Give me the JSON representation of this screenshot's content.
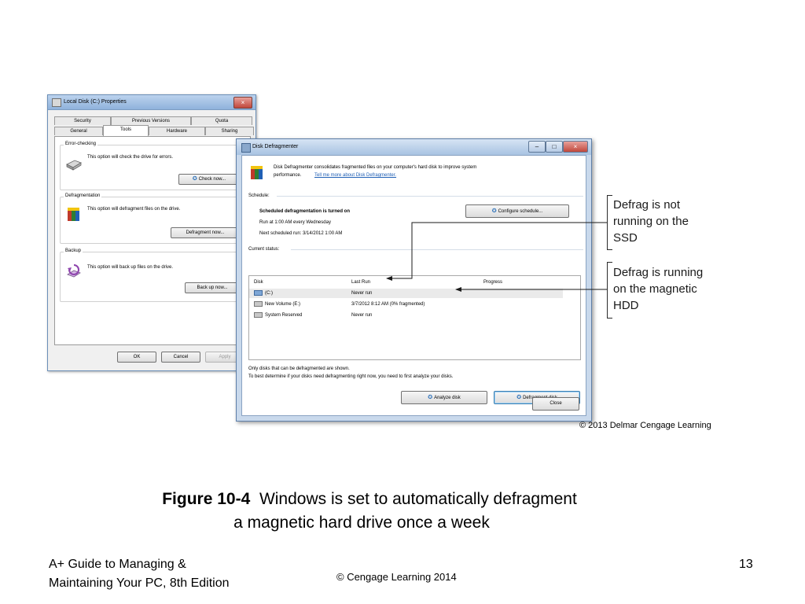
{
  "properties_window": {
    "title": "Local Disk (C:) Properties",
    "close_glyph": "×",
    "tabs_back": [
      "Security",
      "Previous Versions",
      "Quota"
    ],
    "tabs_front": [
      "General",
      "Tools",
      "Hardware",
      "Sharing"
    ],
    "active_tab": "Tools",
    "error_checking": {
      "title": "Error-checking",
      "text": "This option will check the drive for errors.",
      "button": "Check now..."
    },
    "defragmentation": {
      "title": "Defragmentation",
      "text": "This option will defragment files on the drive.",
      "button": "Defragment now..."
    },
    "backup": {
      "title": "Backup",
      "text": "This option will back up files on the drive.",
      "button": "Back up now..."
    },
    "buttons": {
      "ok": "OK",
      "cancel": "Cancel",
      "apply": "Apply"
    }
  },
  "defrag_window": {
    "title": "Disk Defragmenter",
    "window_buttons": {
      "minimize": "–",
      "maximize": "□",
      "close": "×"
    },
    "intro_text": "Disk Defragmenter consolidates fragmented files on your computer's hard disk to improve system",
    "intro_text2": "performance.",
    "intro_link": "Tell me more about Disk Defragmenter.",
    "schedule_label": "Schedule:",
    "schedule_status": "Scheduled defragmentation is turned on",
    "schedule_run": "Run at 1:00 AM every Wednesday",
    "schedule_next": "Next scheduled run: 3/14/2012 1:00 AM",
    "configure_button": "Configure schedule...",
    "current_status_label": "Current status:",
    "columns": [
      "Disk",
      "Last Run",
      "Progress"
    ],
    "disks": [
      {
        "disk": "(C:)",
        "last_run": "Never run",
        "progress": ""
      },
      {
        "disk": "New Volume (E:)",
        "last_run": "3/7/2012 8:12 AM (0% fragmented)",
        "progress": ""
      },
      {
        "disk": "System Reserved",
        "last_run": "Never run",
        "progress": ""
      }
    ],
    "note1": "Only disks that can be defragmented are shown.",
    "note2": "To best determine if your disks need defragmenting right now, you need to first analyze your disks.",
    "analyze_button": "Analyze disk",
    "defragment_button": "Defragment disk",
    "close_button": "Close"
  },
  "callouts": {
    "ssd": [
      "Defrag is not",
      "running on the",
      "SSD"
    ],
    "hdd": [
      "Defrag is running",
      "on the magnetic",
      "HDD"
    ]
  },
  "copyright_image": "© 2013 Delmar Cengage Learning",
  "caption": {
    "label": "Figure 10-4",
    "line1": "Windows is set to automatically defragment",
    "line2": "a magnetic hard drive once a week"
  },
  "footer": {
    "book_line1": "A+ Guide to Managing &",
    "book_line2": "Maintaining Your PC, 8th Edition",
    "copyright": "© Cengage Learning  2014",
    "page_number": "13"
  }
}
